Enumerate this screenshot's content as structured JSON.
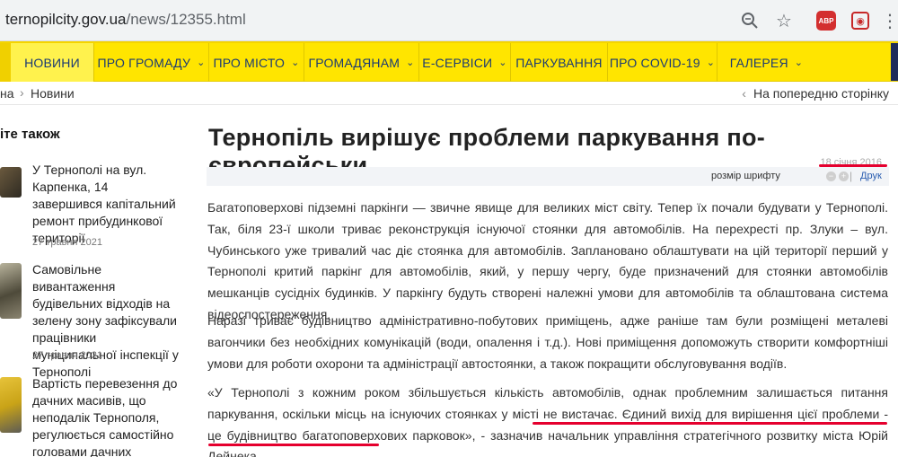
{
  "browser": {
    "url_host": "ternopilcity.gov.ua",
    "url_path": "/news/12355.html",
    "icons": [
      "zoom-icon",
      "star-icon",
      "abp-icon",
      "extension-icon",
      "menu-icon"
    ],
    "abp_label": "ABP"
  },
  "nav": {
    "items": [
      {
        "label": "НОВИНИ",
        "has_chevron": false
      },
      {
        "label": "ПРО ГРОМАДУ",
        "has_chevron": true
      },
      {
        "label": "ПРО МІСТО",
        "has_chevron": true
      },
      {
        "label": "ГРОМАДЯНАМ",
        "has_chevron": true
      },
      {
        "label": "Е-СЕРВІСИ",
        "has_chevron": true
      },
      {
        "label": "ПАРКУВАННЯ",
        "has_chevron": false
      },
      {
        "label": "ПРО COVID-19",
        "has_chevron": true
      },
      {
        "label": "ГАЛЕРЕЯ",
        "has_chevron": true
      }
    ],
    "colors": {
      "background": "#ffe500",
      "text": "#1b3a73"
    }
  },
  "breadcrumb": {
    "home": "на",
    "separator": "›",
    "current": "Новини",
    "back_label": "На попередню сторінку"
  },
  "sidebar": {
    "title": "іте також",
    "items": [
      {
        "text": "У Тернополі на вул. Карпенка, 14 завершився капітальний ремонт прибудинкової території",
        "date": "27 травня 2021"
      },
      {
        "text": "Самовільне вивантаження будівельних відходів на зелену зону зафіксували працівники муніципальної інспекції у Тернополі",
        "date": "27 травня 2021"
      },
      {
        "text": "Вартість перевезення до дачних масивів, що неподалік Тернополя, регулюється самостійно головами дачних",
        "date": ""
      }
    ]
  },
  "article": {
    "title": "Тернопіль вирішує проблеми паркування по-європейськи",
    "date": "18 січня 2016",
    "font_size_label": "розмір шрифту",
    "font_minus": "−",
    "font_plus": "+",
    "print_label": "Друк",
    "paragraphs": [
      "Багатоповерхові підземні паркінги — звичне явище для великих міст світу. Тепер їх почали будувати у Тернополі. Так, біля 23-ї школи триває реконструкція існуючої стоянки для автомобілів. На перехресті пр. Злуки – вул. Чубинського уже тривалий час діє стоянка для автомобілів. Заплановано облаштувати на цій території перший у Тернополі критий паркінг для автомобілів, який, у першу чергу, буде призначений для стоянки автомобілів мешканців сусідніх будинків. У паркінгу будуть створені належні умови для автомобілів та облаштована система відеоспостереження.",
      "Наразі триває будівництво адміністративно-побутових приміщень, адже раніше там були розміщені металеві вагончики без необхідних комунікацій (води, опалення і т.д.). Нові приміщення допоможуть створити комфортніші умови для роботи охорони та адміністрації автостоянки, а також покращити обслуговування водіїв.",
      "«У Тернополі з кожним роком збільшується кількість автомобілів, однак проблемним залишається питання паркування, оскільки місць на існуючих стоянках у місті не вистачає. Єдиний вихід для вирішення цієї проблеми - це будівництво багатоповерхових парковок», - зазначив начальник управління стратегічного розвитку міста Юрій Дейнека."
    ],
    "highlight_color": "#e5002e"
  }
}
